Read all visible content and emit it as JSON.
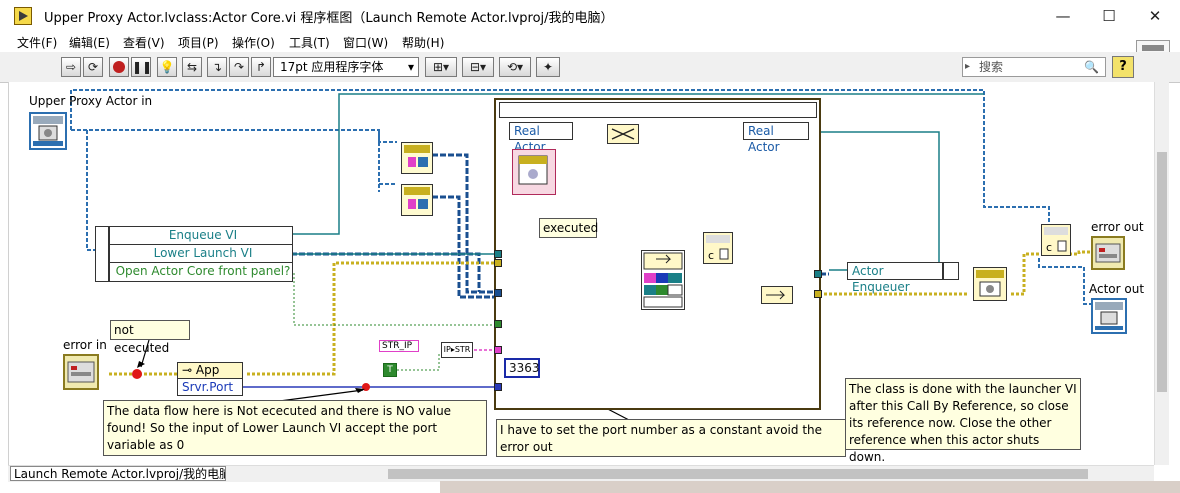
{
  "window": {
    "title": "Upper Proxy Actor.lvclass:Actor Core.vi 程序框图（Launch Remote Actor.lvproj/我的电脑）",
    "minimize": "—",
    "maximize": "☐",
    "close": "✕"
  },
  "menu": [
    "文件(F)",
    "编辑(E)",
    "查看(V)",
    "项目(P)",
    "操作(O)",
    "工具(T)",
    "窗口(W)",
    "帮助(H)"
  ],
  "toolbar": {
    "font": "17pt 应用程序字体",
    "search_placeholder": "搜索",
    "help": "?"
  },
  "diagram": {
    "upper_proxy_label": "Upper Proxy Actor in",
    "error_in_label": "error in",
    "error_out_label": "error out",
    "actor_out_label": "Actor out",
    "unbundle_rows": [
      "Enqueue VI",
      "Lower Launch VI",
      "Open Actor Core front panel?"
    ],
    "real_actor_in": "Real Actor",
    "real_actor_out": "Real Actor",
    "actor_enqueuer": "Actor Enqueuer",
    "app_label": "App",
    "srvr_port": "Srvr.Port",
    "str_ip": "STR_IP",
    "str": "STR",
    "ip": "IP",
    "true_const": "T",
    "port_const": "3363"
  },
  "notes": {
    "executed": "executed",
    "not_executed": "not ececuted",
    "dataflow": "The data flow here is Not ececuted and there is NO value found! So the input of Lower Launch VI accept the port variable as 0",
    "port_const": "I have to set the port number as a constant avoid the error out",
    "class_done": "The class is done with the launcher VI after this Call By Reference, so close its reference now. Close the other reference when this actor shuts down."
  },
  "status": {
    "project": "Launch Remote Actor.lvproj/我的电脑"
  },
  "colors": {
    "class_wire": "#2c6fb0",
    "error_wire": "#c8b020",
    "ref_wire": "#1a7f87",
    "string_wire": "#e040c8",
    "int_wire": "#2a3ab8",
    "bool_wire": "#2e8a2e",
    "note_bg": "#ffffe0"
  }
}
